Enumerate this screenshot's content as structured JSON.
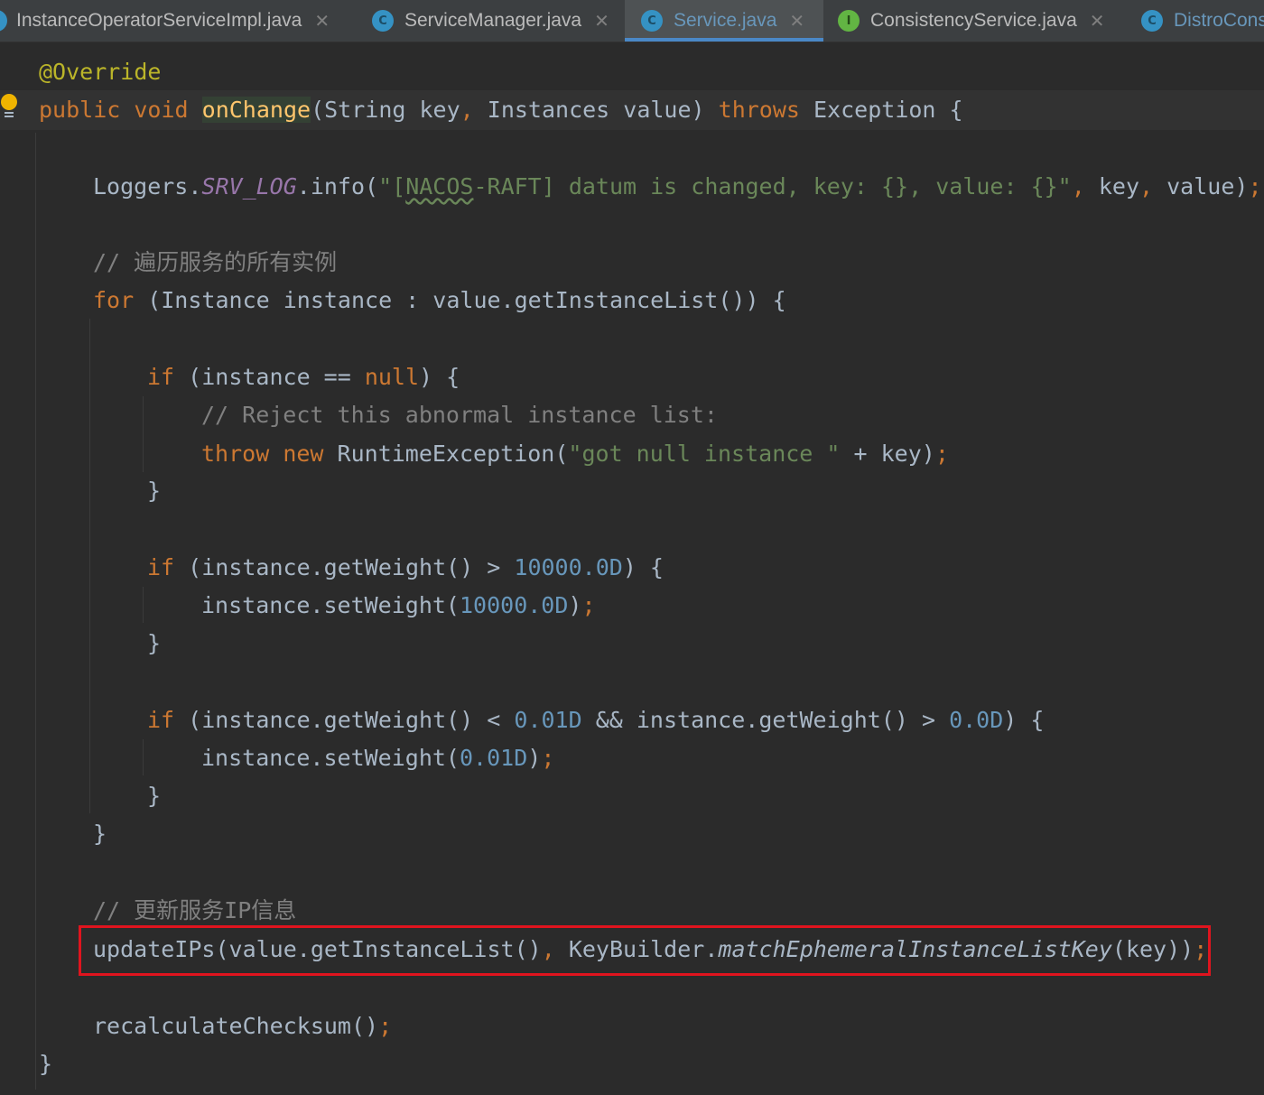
{
  "tabs": [
    {
      "name": "InstanceOperatorServiceImpl.java",
      "icon": "class-icon",
      "close": "✕"
    },
    {
      "name": "ServiceManager.java",
      "icon": "class-icon",
      "icon_letter": "C",
      "close": "✕"
    },
    {
      "name": "Service.java",
      "icon": "class-icon",
      "icon_letter": "C",
      "close": "✕",
      "active": true
    },
    {
      "name": "ConsistencyService.java",
      "icon": "interface-icon",
      "icon_letter": "I",
      "close": "✕"
    },
    {
      "name": "DistroCons",
      "icon": "class-icon",
      "icon_letter": "C"
    }
  ],
  "code": {
    "l1_annotation": "@Override",
    "l2_public": "public",
    "l2_void": "void",
    "l2_method": "onChange",
    "l2_params": "(String key",
    "l2_comma": ",",
    "l2_params2": " Instances value) ",
    "l2_throws": "throws",
    "l2_tail": " Exception {",
    "l3_loggers": "Loggers.",
    "l3_field": "SRV_LOG",
    "l3_info": ".info(",
    "l3_str_a": "\"[",
    "l3_str_b": "NACOS",
    "l3_str_c": "-RAFT] datum is changed, key: {}, value: {}\"",
    "l3_comma1": ",",
    "l3_key": " key",
    "l3_comma2": ",",
    "l3_value": " value)",
    "l3_semi": ";",
    "l4_comment": "// 遍历服务的所有实例",
    "l5_for": "for",
    "l5_rest": " (Instance instance : value.getInstanceList()) {",
    "l6_if": "if",
    "l6_mid": " (instance == ",
    "l6_null": "null",
    "l6_tail": ") {",
    "l7_comment": "// Reject this abnormal instance list:",
    "l8_throw": "throw",
    "l8_new": "new",
    "l8_exc": " RuntimeException(",
    "l8_str": "\"got null instance \"",
    "l8_tail": " + key)",
    "l8_semi": ";",
    "l9_brace": "}",
    "l10_if": "if",
    "l10_mid": " (instance.getWeight() > ",
    "l10_num": "10000.0D",
    "l10_tail": ") {",
    "l11_call": "instance.setWeight(",
    "l11_num": "10000.0D",
    "l11_close": ")",
    "l11_semi": ";",
    "l12_brace": "}",
    "l13_if": "if",
    "l13_mid": " (instance.getWeight() < ",
    "l13_num1": "0.01D",
    "l13_mid2": " && instance.getWeight() > ",
    "l13_num2": "0.0D",
    "l13_tail": ") {",
    "l14_call": "instance.setWeight(",
    "l14_num": "0.01D",
    "l14_close": ")",
    "l14_semi": ";",
    "l15_brace": "}",
    "l16_brace": "}",
    "l17_comment": "// 更新服务IP信息",
    "l18_call": "updateIPs(value.getInstanceList()",
    "l18_comma": ",",
    "l18_kb": " KeyBuilder.",
    "l18_method": "matchEphemeralInstanceListKey",
    "l18_tail": "(key))",
    "l18_semi": ";",
    "l19_call": "recalculateChecksum()",
    "l19_semi": ";",
    "l20_brace": "}"
  },
  "colors": {
    "background": "#2b2b2b",
    "keyword": "#cc7832",
    "string": "#6a8759",
    "number": "#6897bb",
    "comment": "#808080",
    "highlight_box": "#e0141e"
  }
}
